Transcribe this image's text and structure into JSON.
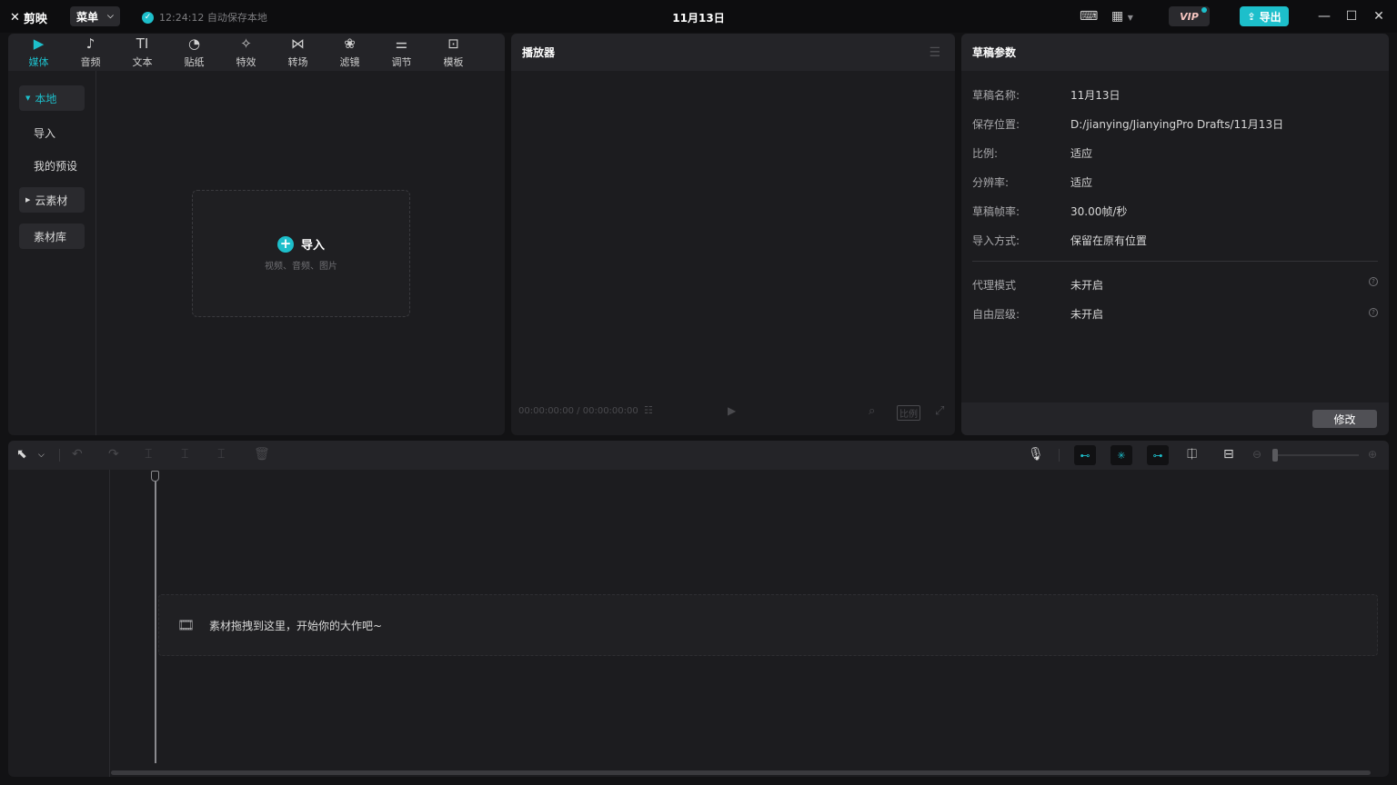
{
  "app": {
    "name": "剪映",
    "menu_label": "菜单",
    "save_status": "12:24:12 自动保存本地",
    "document_title": "11月13日",
    "vip_label": "VIP",
    "export_label": "导出"
  },
  "media_panel": {
    "tabs": [
      {
        "label": "媒体",
        "icon": "media-icon",
        "glyph": "▶"
      },
      {
        "label": "音频",
        "icon": "music-icon",
        "glyph": "♪"
      },
      {
        "label": "文本",
        "icon": "text-icon",
        "glyph": "TI"
      },
      {
        "label": "贴纸",
        "icon": "sticker-icon",
        "glyph": "◔"
      },
      {
        "label": "特效",
        "icon": "effects-icon",
        "glyph": "✧"
      },
      {
        "label": "转场",
        "icon": "transition-icon",
        "glyph": "⋈"
      },
      {
        "label": "滤镜",
        "icon": "filter-icon",
        "glyph": "❀"
      },
      {
        "label": "调节",
        "icon": "adjust-icon",
        "glyph": "⚌"
      },
      {
        "label": "模板",
        "icon": "template-icon",
        "glyph": "⊡"
      }
    ],
    "nav": {
      "local": "本地",
      "import": "导入",
      "my_presets": "我的预设",
      "cloud": "云素材",
      "library": "素材库"
    },
    "import_box": {
      "label": "导入",
      "hint": "视频、音频、图片"
    }
  },
  "player": {
    "title": "播放器",
    "timecode": "00:00:00:00 / 00:00:00:00",
    "ratio_label": "比例"
  },
  "draft_params": {
    "title": "草稿参数",
    "rows": [
      {
        "key": "草稿名称:",
        "value": "11月13日"
      },
      {
        "key": "保存位置:",
        "value": "D:/jianying/JianyingPro Drafts/11月13日"
      },
      {
        "key": "比例:",
        "value": "适应"
      },
      {
        "key": "分辨率:",
        "value": "适应"
      },
      {
        "key": "草稿帧率:",
        "value": "30.00帧/秒"
      },
      {
        "key": "导入方式:",
        "value": "保留在原有位置"
      }
    ],
    "extra_rows": [
      {
        "key": "代理模式",
        "value": "未开启"
      },
      {
        "key": "自由层级:",
        "value": "未开启"
      }
    ],
    "modify_label": "修改"
  },
  "timeline": {
    "drop_hint": "素材拖拽到这里，开始你的大作吧~"
  },
  "colors": {
    "accent": "#1dbfcb",
    "panel_bg": "#1c1c1f",
    "header_bg": "#242428",
    "window_bg": "#121214"
  }
}
